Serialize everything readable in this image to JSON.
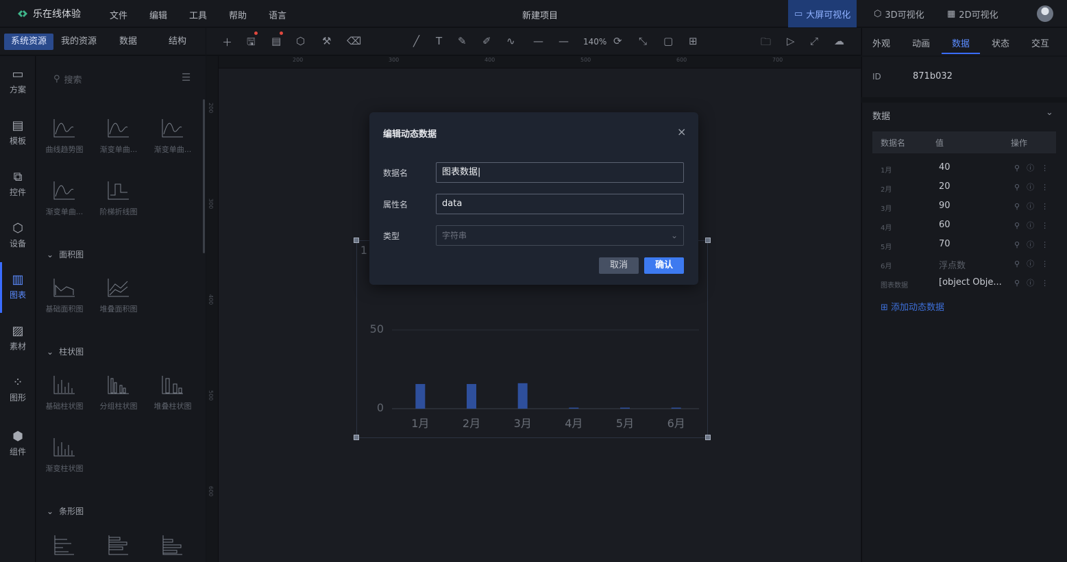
{
  "app": {
    "name": "乐在线体验"
  },
  "menu": [
    "文件",
    "编辑",
    "工具",
    "帮助",
    "语言"
  ],
  "project_title": "新建项目",
  "modes": [
    {
      "label": "大屏可视化",
      "active": true
    },
    {
      "label": "3D可视化",
      "active": false
    },
    {
      "label": "2D可视化",
      "active": false
    }
  ],
  "left_tabs": [
    "系统资源",
    "我的资源",
    "数据",
    "结构"
  ],
  "rail": [
    {
      "label": "方案",
      "icon": "monitor-icon"
    },
    {
      "label": "模板",
      "icon": "template-icon"
    },
    {
      "label": "控件",
      "icon": "widget-icon"
    },
    {
      "label": "设备",
      "icon": "cube-icon"
    },
    {
      "label": "图表",
      "icon": "chart-icon",
      "active": true
    },
    {
      "label": "素材",
      "icon": "image-icon"
    },
    {
      "label": "图形",
      "icon": "shape-icon"
    },
    {
      "label": "组件",
      "icon": "component-icon"
    }
  ],
  "resources": {
    "search_placeholder": "搜索",
    "line_items": [
      "曲线趋势图",
      "渐变单曲...",
      "渐变单曲...",
      "渐变单曲...",
      "阶梯折线图"
    ],
    "area_section": "面积图",
    "area_items": [
      "基础面积图",
      "堆叠面积图"
    ],
    "bar_section": "柱状图",
    "bar_items": [
      "基础柱状图",
      "分组柱状图",
      "堆叠柱状图",
      "渐变柱状图"
    ],
    "hbar_section": "条形图"
  },
  "toolbar": {
    "zoom": "140%"
  },
  "ruler": {
    "top": [
      "200",
      "300",
      "400",
      "500",
      "600",
      "700"
    ],
    "left": [
      "200",
      "300",
      "400",
      "500",
      "600"
    ]
  },
  "chart_data": {
    "type": "bar",
    "categories": [
      "1月",
      "2月",
      "3月",
      "4月",
      "5月",
      "6月"
    ],
    "values": [
      26,
      26,
      27,
      0,
      0,
      0
    ],
    "y_ticks": [
      "1",
      "50",
      "0"
    ],
    "ylim": [
      0,
      100
    ],
    "bar_color": "#2e4f9c",
    "grid": true
  },
  "dialog": {
    "title": "编辑动态数据",
    "close": "×",
    "fields": [
      {
        "label": "数据名",
        "value": "图表数据"
      },
      {
        "label": "属性名",
        "value": "data"
      },
      {
        "label": "类型",
        "value": "字符串"
      }
    ],
    "cancel": "取消",
    "confirm": "确认"
  },
  "right": {
    "tabs": [
      "外观",
      "动画",
      "数据",
      "状态",
      "交互"
    ],
    "active_tab": "数据",
    "id_label": "ID",
    "id_value": "871b032",
    "section": "数据",
    "columns": [
      "数据名",
      "值",
      "操作"
    ],
    "rows": [
      {
        "name": "1月",
        "value": "40"
      },
      {
        "name": "2月",
        "value": "20"
      },
      {
        "name": "3月",
        "value": "90"
      },
      {
        "name": "4月",
        "value": "60"
      },
      {
        "name": "5月",
        "value": "70"
      },
      {
        "name": "6月",
        "value": "浮点数",
        "muted": true
      },
      {
        "name": "图表数据",
        "value": "[object Obje..."
      }
    ],
    "add_label": "添加动态数据"
  },
  "colors": {
    "accent": "#3d7af0",
    "active_mode_bg": "#1f3c76",
    "bar": "#2e4f9c"
  }
}
